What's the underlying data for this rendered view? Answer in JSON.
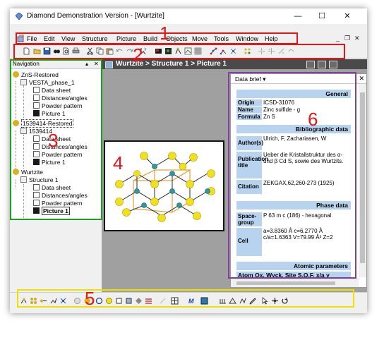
{
  "window": {
    "title": "Diamond Demonstration Version - [Wurtzite]",
    "controls": {
      "minimize": "—",
      "maximize": "☐",
      "close": "✕"
    }
  },
  "menubar": {
    "items": [
      "File",
      "Edit",
      "View",
      "Structure",
      "Picture",
      "Build",
      "Objects",
      "Move",
      "Tools",
      "Window",
      "Help"
    ],
    "mdi_controls": {
      "minimize": "_",
      "restore": "❐",
      "close": "✕"
    }
  },
  "navigation": {
    "title": "Navigation",
    "controls": {
      "pin": "▴",
      "close": "✕"
    },
    "tree": [
      {
        "label": "ZnS-Restored",
        "icon": "structure-icon"
      },
      {
        "label": "VESTA_phase_1",
        "icon": "grid-icon"
      },
      {
        "label": "Data sheet",
        "icon": "data-sheet-icon"
      },
      {
        "label": "Distances/angles",
        "icon": "distances-icon"
      },
      {
        "label": "Powder pattern",
        "icon": "powder-icon"
      },
      {
        "label": "Picture 1",
        "icon": "picture-icon"
      },
      {
        "label": "1539414-Restored",
        "icon": "structure-icon"
      },
      {
        "label": "1539414",
        "icon": "grid-icon"
      },
      {
        "label": "Data sheet",
        "icon": "data-sheet-icon"
      },
      {
        "label": "Distances/angles",
        "icon": "distances-icon"
      },
      {
        "label": "Powder pattern",
        "icon": "powder-icon"
      },
      {
        "label": "Picture 1",
        "icon": "picture-icon"
      },
      {
        "label": "Wurtzite",
        "icon": "structure-icon"
      },
      {
        "label": "Structure 1",
        "icon": "grid-icon"
      },
      {
        "label": "Data sheet",
        "icon": "data-sheet-icon"
      },
      {
        "label": "Distances/angles",
        "icon": "distances-icon"
      },
      {
        "label": "Powder pattern",
        "icon": "powder-icon"
      },
      {
        "label": "Picture 1",
        "icon": "picture-icon"
      }
    ]
  },
  "document": {
    "breadcrumb": "Wurtzite > Structure 1 > Picture 1"
  },
  "data_brief": {
    "title": "Data brief",
    "dropdown_arrow": "▾",
    "close": "✕",
    "sections": {
      "general": "General",
      "bibliographic": "Bibliographic data",
      "phase": "Phase data",
      "atomic": "Atomic parameters"
    },
    "general": [
      {
        "key": "Origin",
        "value": "ICSD-31076"
      },
      {
        "key": "Name",
        "value": "Zinc sulfide - g"
      },
      {
        "key": "Formula",
        "value": "Zn S"
      }
    ],
    "bibliographic": [
      {
        "key": "Author(s)",
        "value": "Ulrich, F, Zachariasen, W"
      },
      {
        "key": "Publication title",
        "value": "Ueber die Kristallstruktur des α- und β Cd S, sowie des Wurtzits."
      },
      {
        "key": "Citation",
        "value": "ZEKGAX,62,260-273 (1925)"
      }
    ],
    "phase": [
      {
        "key": "Space-group",
        "value": "P 63 m c (186) - hexagonal"
      },
      {
        "key": "Cell",
        "value": "a=3.8360 Å c=6.2770 Å c/a=1.6363 V=79.99 Å³ Z=2"
      }
    ],
    "atomic_header": "Atom Ox. Wyck. Site S.O.F. x/a y"
  },
  "annotations": {
    "colors": {
      "red": "#e01818",
      "green": "#1aa01a",
      "yellow": "#f0e000",
      "purple": "#8040a0",
      "black": "#111111"
    },
    "labels": [
      "1",
      "2",
      "3",
      "4",
      "5",
      "6"
    ]
  },
  "icons": {
    "toolbar1": [
      "new-icon",
      "open-icon",
      "save-icon",
      "find-icon",
      "preview-icon",
      "print-icon",
      "cut-icon",
      "copy-icon",
      "paste-icon",
      "undo-icon",
      "redo-icon",
      "help-icon",
      "picture-icon",
      "build-icon",
      "rotate-icon",
      "image-icon",
      "grid-icon",
      "molecule-icon",
      "polyhedra-icon",
      "cell-icon",
      "bond-icon",
      "expand-icon",
      "atom-icon",
      "move-icon"
    ],
    "toolbar2": [
      "connect-icon",
      "atoms-icon",
      "bonds-icon",
      "chain-icon",
      "cluster-icon",
      "ring-icon",
      "color-icon",
      "circle-icon",
      "sphere-icon",
      "square-icon",
      "diamond-icon",
      "stripe-icon",
      "axis-icon",
      "box-icon",
      "matrix-icon",
      "style-icon",
      "measure-icon",
      "angle-icon",
      "torsion-icon",
      "pencil-icon",
      "pointer-icon",
      "move-icon",
      "rotate-icon"
    ]
  }
}
